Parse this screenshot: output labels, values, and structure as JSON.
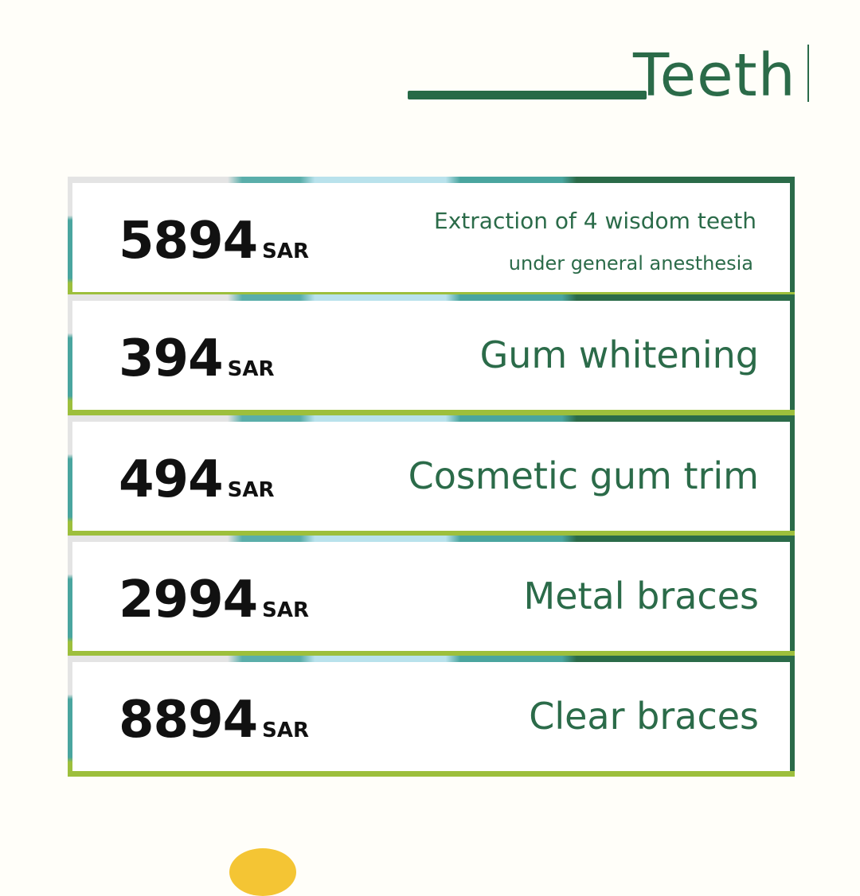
{
  "header": {
    "title": "Teeth"
  },
  "currency": "SAR",
  "services": [
    {
      "price": "5894",
      "name_line1": "Extraction of 4 wisdom teeth",
      "name_line2": "under general anesthesia"
    },
    {
      "price": "394",
      "name": "Gum whitening"
    },
    {
      "price": "494",
      "name": "Cosmetic gum trim"
    },
    {
      "price": "2994",
      "name": "Metal braces"
    },
    {
      "price": "8894",
      "name": "Clear braces"
    }
  ],
  "colors": {
    "accent_green": "#2b6b49",
    "teal": "#4aa59f",
    "light_blue": "#b9e2ec",
    "lime": "#9dbf3c",
    "yellow": "#f4c534"
  }
}
